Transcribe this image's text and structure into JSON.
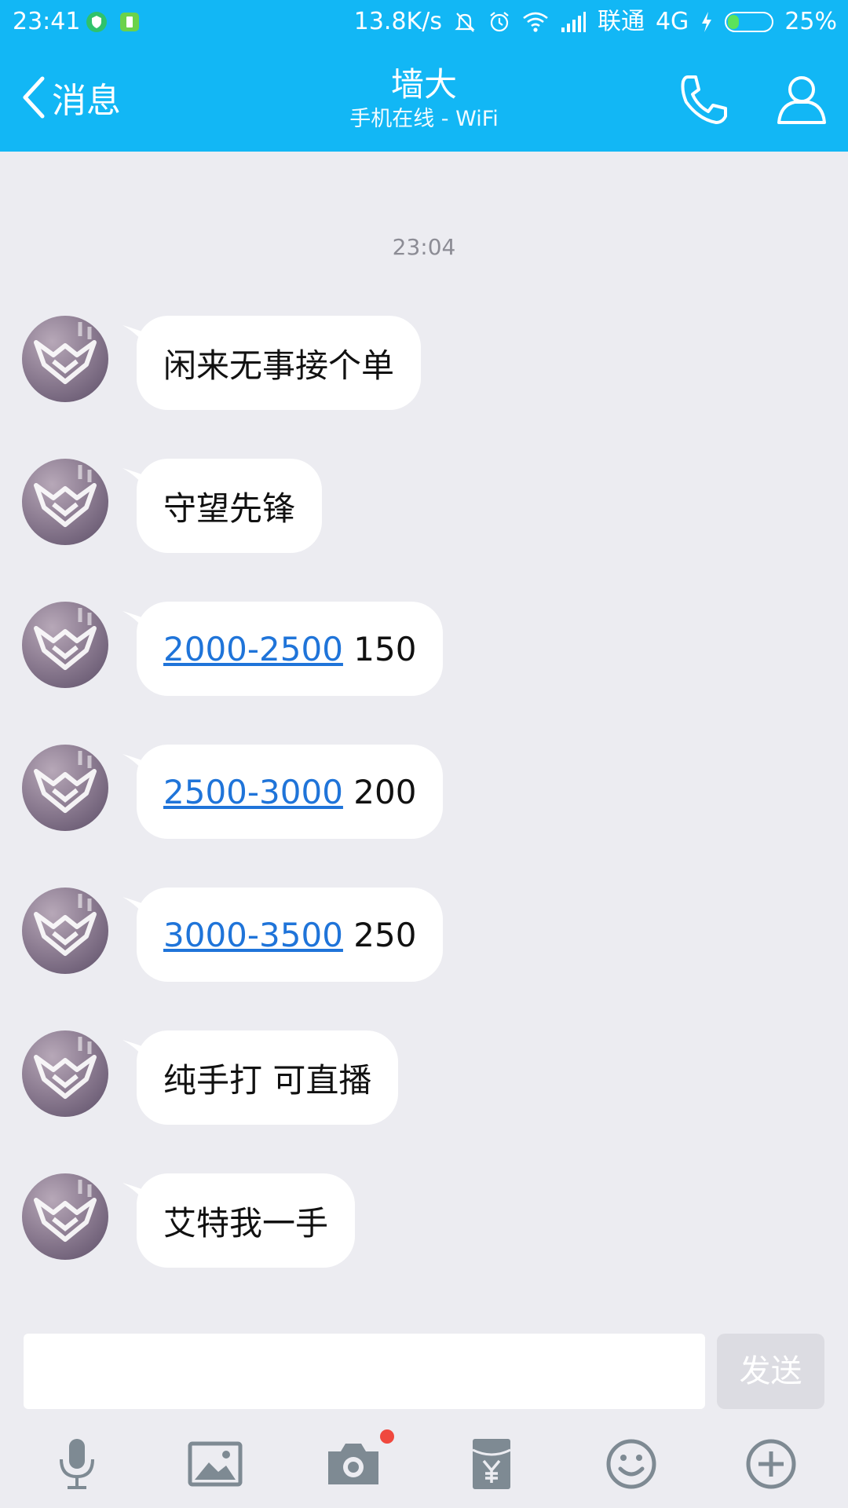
{
  "status_bar": {
    "time": "23:41",
    "net_speed": "13.8K/s",
    "carrier": "联通",
    "network": "4G",
    "battery": "25%",
    "battery_level": 0.25
  },
  "header": {
    "back_label": "消息",
    "contact_name": "墙大",
    "contact_status": "手机在线 - WiFi"
  },
  "chat": {
    "timestamp": "23:04",
    "messages": [
      {
        "text": "闲来无事接个单"
      },
      {
        "text": "守望先锋"
      },
      {
        "link": "2000-2500",
        "text": " 150"
      },
      {
        "link": "2500-3000",
        "text": " 200"
      },
      {
        "link": "3000-3500",
        "text": " 250"
      },
      {
        "text": "纯手打 可直播"
      },
      {
        "text": "艾特我一手"
      }
    ]
  },
  "input": {
    "value": "",
    "send_label": "发送"
  },
  "toolbar": {
    "icons": [
      "microphone-icon",
      "image-icon",
      "camera-icon",
      "red-packet-icon",
      "emoji-icon",
      "plus-icon"
    ]
  },
  "colors": {
    "header_bg": "#12B7F5",
    "chat_bg": "#ECECF1",
    "link": "#1F74D9",
    "notification_dot": "#F0483E"
  }
}
